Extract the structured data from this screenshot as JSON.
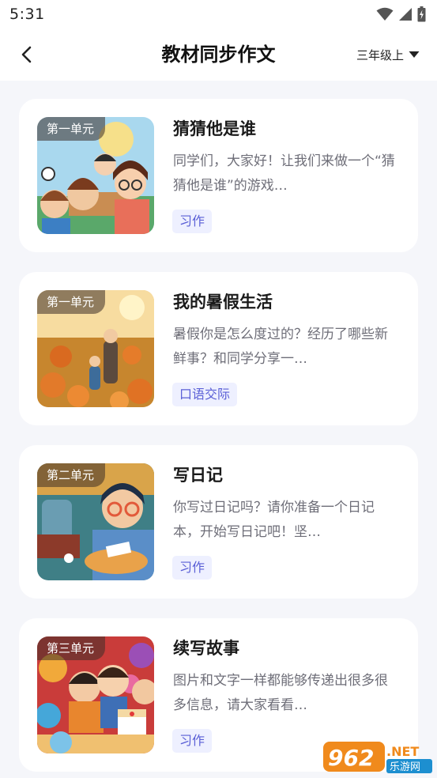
{
  "status_bar": {
    "time": "5:31"
  },
  "header": {
    "title": "教材同步作文",
    "grade_selector": "三年级上"
  },
  "cards": [
    {
      "unit": "第一单元",
      "title": "猜猜他是谁",
      "description": "同学们，大家好！让我们来做一个“猜猜他是谁”的游戏…",
      "tag": "习作"
    },
    {
      "unit": "第一单元",
      "title": "我的暑假生活",
      "description": "暑假你是怎么度过的？经历了哪些新鲜事？和同学分享一…",
      "tag": "口语交际"
    },
    {
      "unit": "第二单元",
      "title": "写日记",
      "description": "你写过日记吗？请你准备一个日记本，开始写日记吧！坚…",
      "tag": "习作"
    },
    {
      "unit": "第三单元",
      "title": "续写故事",
      "description": "图片和文字一样都能够传递出很多很多信息，请大家看看…",
      "tag": "习作"
    }
  ],
  "watermark": {
    "number": "962",
    "suffix": ".NET",
    "text": "乐游网"
  },
  "colors": {
    "accent": "#5a5fd6",
    "tag_bg": "#eef0ff",
    "page_bg": "#f5f6fa"
  }
}
